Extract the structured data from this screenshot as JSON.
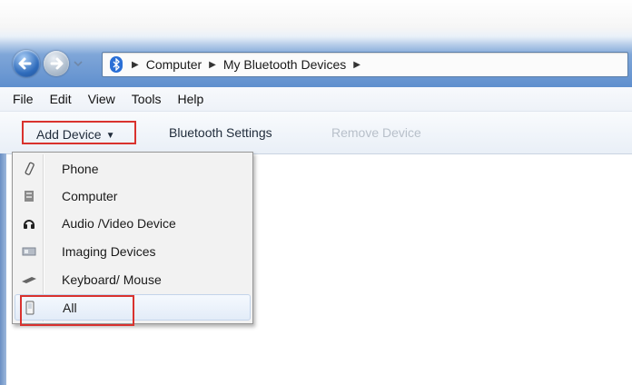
{
  "address_bar": {
    "crumbs": [
      "Computer",
      "My Bluetooth Devices"
    ]
  },
  "menubar": {
    "items": [
      "File",
      "Edit",
      "View",
      "Tools",
      "Help"
    ]
  },
  "toolbar": {
    "add_device_label": "Add Device",
    "bluetooth_settings_label": "Bluetooth Settings",
    "remove_device_label": "Remove Device"
  },
  "dropdown": {
    "items": [
      {
        "label": "Phone",
        "icon": "phone-icon"
      },
      {
        "label": "Computer",
        "icon": "computer-icon"
      },
      {
        "label": "Audio /Video Device",
        "icon": "headphones-icon"
      },
      {
        "label": "Imaging Devices",
        "icon": "scanner-icon"
      },
      {
        "label": "Keyboard/ Mouse",
        "icon": "keyboard-icon"
      },
      {
        "label": "All",
        "icon": "device-icon"
      }
    ]
  },
  "colors": {
    "highlight_red": "#d9322e",
    "titlebar_blue": "#5f8fce"
  }
}
